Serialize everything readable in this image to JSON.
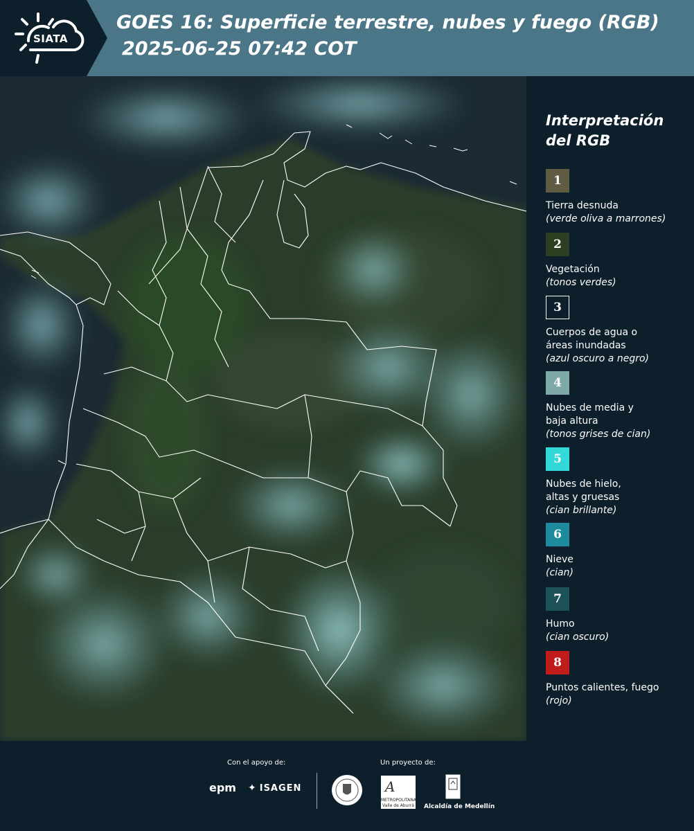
{
  "header": {
    "logo_text": "SIATA",
    "title_line1": "GOES 16: Superficie terrestre, nubes y fuego (RGB)",
    "title_line2": "2025-06-25 07:42 COT"
  },
  "legend": {
    "title_line1": "Interpretación",
    "title_line2": "del RGB",
    "items": [
      {
        "number": "1",
        "label": "Tierra desnuda",
        "label2": "",
        "desc": "(verde oliva a marrones)",
        "color": "#5f5c43",
        "border": ""
      },
      {
        "number": "2",
        "label": "Vegetación",
        "label2": "",
        "desc": "(tonos verdes)",
        "color": "#2c3f22",
        "border": ""
      },
      {
        "number": "3",
        "label": "Cuerpos de agua o",
        "label2": "áreas inundadas",
        "desc": "(azul oscuro a negro)",
        "color": "#0c1f2b",
        "border": "#ffffff"
      },
      {
        "number": "4",
        "label": "Nubes de media y",
        "label2": "baja altura",
        "desc": "(tonos grises de cian)",
        "color": "#7fa9a8",
        "border": ""
      },
      {
        "number": "5",
        "label": "Nubes de hielo,",
        "label2": "altas y gruesas",
        "desc": "(cian brillante)",
        "color": "#32d9d9",
        "border": ""
      },
      {
        "number": "6",
        "label": "Nieve",
        "label2": "",
        "desc": "(cian)",
        "color": "#1e8a9e",
        "border": ""
      },
      {
        "number": "7",
        "label": "Humo",
        "label2": "",
        "desc": "(cian oscuro)",
        "color": "#1d5358",
        "border": ""
      },
      {
        "number": "8",
        "label": "Puntos calientes, fuego",
        "label2": "",
        "desc": "(rojo)",
        "color": "#c01c1c",
        "border": ""
      }
    ]
  },
  "footer": {
    "support_label": "Con el apoyo de:",
    "project_label": "Un proyecto de:",
    "epm": "epm",
    "isagen": "ISAGEN",
    "amva_line1": "METROPOLITANA",
    "amva_line2": "Valle de Aburrá",
    "alcaldia": "Alcaldía de Medellín"
  }
}
